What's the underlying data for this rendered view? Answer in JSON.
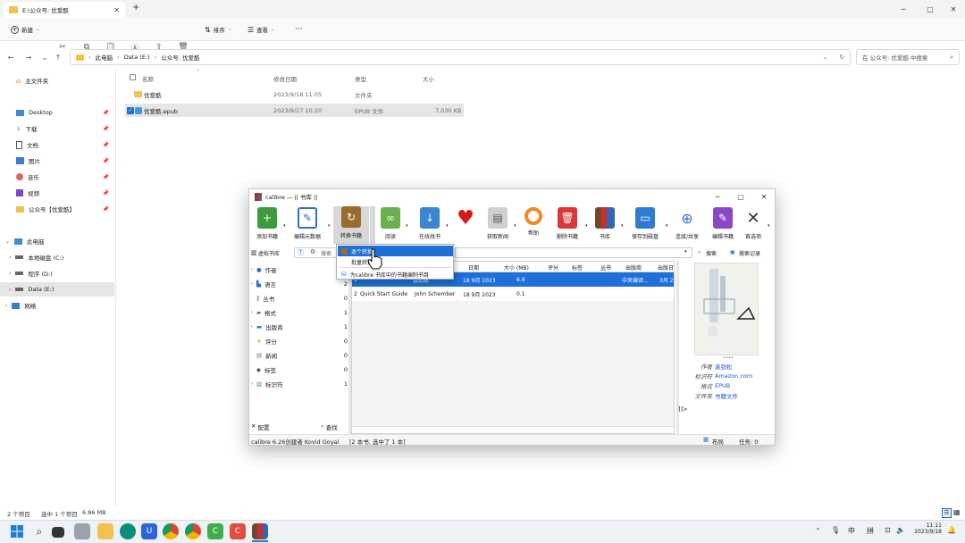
{
  "explorer": {
    "tab_title": "E:\\公众号: 优爱酷",
    "new_tab": "+",
    "new_label": "新建",
    "sort_label": "排序",
    "view_label": "查看",
    "more": "···",
    "breadcrumb": [
      "此电脑",
      "Data (E:)",
      "公众号: 优爱酷"
    ],
    "search_placeholder": "在 公众号: 优爱酷 中搜索",
    "sidebar": {
      "home": "主文件夹",
      "pinned": [
        "Desktop",
        "下载",
        "文档",
        "图片",
        "音乐",
        "视频",
        "公众号【优爱酷】"
      ],
      "pc": "此电脑",
      "drives": [
        "本地磁盘 (C:)",
        "程序 (D:)",
        "Data (E:)"
      ],
      "network": "网络"
    },
    "columns": {
      "name": "名称",
      "date": "修改日期",
      "type": "类型",
      "size": "大小"
    },
    "files": [
      {
        "name": "优爱酷",
        "date": "2023/9/18 11:05",
        "type": "文件夹",
        "size": ""
      },
      {
        "name": "优爱酷.epub",
        "date": "2023/9/17 10:20",
        "type": "EPUB 文件",
        "size": "7,030 KB"
      }
    ],
    "status": {
      "count": "2 个项目",
      "selected": "选中 1 个项目",
      "size": "6.86 MB"
    }
  },
  "calibre": {
    "title": "calibre — || 书库 ||",
    "toolbar": [
      "添加书籍",
      "编辑元数据",
      "转换书籍",
      "阅读",
      "在线找书",
      "",
      "获取新闻",
      "帮助",
      "删除书籍",
      "书库",
      "保存到磁盘",
      "连接/共享",
      "编辑书籍",
      "首选项"
    ],
    "virtual_lib": "虚拟书库",
    "search_label": "搜索",
    "search_btn": "搜索",
    "saved_search": "搜索记录",
    "tags": [
      {
        "label": "作者",
        "count": "2"
      },
      {
        "label": "语言",
        "count": "2"
      },
      {
        "label": "丛书",
        "count": "0"
      },
      {
        "label": "格式",
        "count": "1"
      },
      {
        "label": "出版商",
        "count": "1"
      },
      {
        "label": "评分",
        "count": "0"
      },
      {
        "label": "新闻",
        "count": "0"
      },
      {
        "label": "标签",
        "count": "0"
      },
      {
        "label": "标识符",
        "count": "1"
      }
    ],
    "configure": "配置",
    "find": "查找",
    "book_headers": [
      "日期",
      "大小 (MB)",
      "评分",
      "标签",
      "丛书",
      "出版商",
      "出版日"
    ],
    "books": [
      {
        "num": "1",
        "title": "",
        "author": "袁劲松",
        "date": "18 9月 2023",
        "size": "6.9",
        "publisher": "中央编译...",
        "pubdate": "3月 2"
      },
      {
        "num": "2",
        "title": "Quick Start Guide",
        "author": "John Schember",
        "date": "18 9月 2023",
        "size": "0.1",
        "publisher": "",
        "pubdate": ""
      }
    ],
    "details": {
      "author_k": "作者",
      "author_v": "袁劲松",
      "id_k": "标识符",
      "id_v": "Amazon.com",
      "fmt_k": "格式",
      "fmt_v": "EPUB",
      "folder_k": "文件夹",
      "folder_v": "书籍文件",
      "extra": "]]>"
    },
    "status_left": "calibre 6.26创建者 Kovid Goyal",
    "status_mid": "[2 本书, 选中了 1 本]",
    "layout": "布局",
    "jobs": "任务: 0",
    "menu": [
      "逐个转换",
      "批量转换",
      "为calibre 书库中的书籍编制书目"
    ]
  },
  "taskbar": {
    "ime1": "中",
    "ime2": "拼",
    "time": "11:11",
    "date": "2023/9/18"
  }
}
